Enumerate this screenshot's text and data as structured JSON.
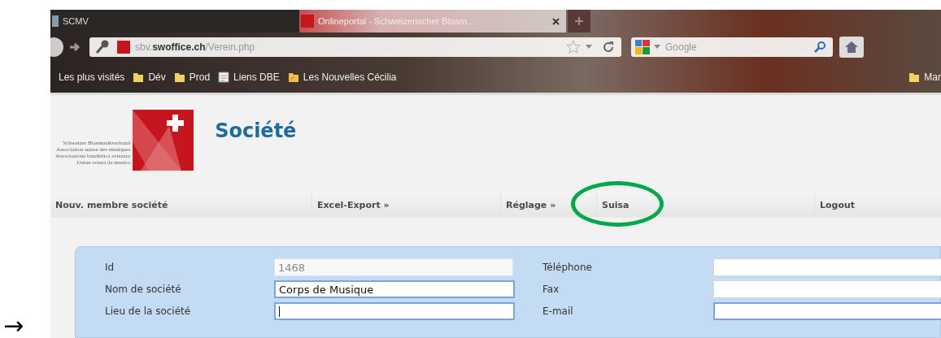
{
  "side_arrow": "→",
  "browser": {
    "tabs": [
      {
        "label": "SCMV",
        "selected": false
      },
      {
        "label": "Onlineportal - Schweizerischer Blasm…",
        "selected": true
      }
    ],
    "address": {
      "prefix": "sbv.",
      "domain": "swoffice.ch",
      "path": "/Verein.php"
    },
    "search": {
      "placeholder": "Google"
    },
    "bookmarks": [
      {
        "label": "Les plus visités",
        "kind": "text"
      },
      {
        "label": "Dév",
        "kind": "folder"
      },
      {
        "label": "Prod",
        "kind": "folder"
      },
      {
        "label": "Liens DBE",
        "kind": "page"
      },
      {
        "label": "Les Nouvelles Cécilia",
        "kind": "feed"
      },
      {
        "label": "Mar",
        "kind": "folder-right"
      }
    ]
  },
  "page": {
    "logo_lines": [
      "Schweizer Blasmusikverband",
      "Association suisse des musiques",
      "Associazione bandistica svizzera",
      "Uniun svizra da musica"
    ],
    "title": "Société",
    "nav": [
      {
        "label": "Nouv. membre société",
        "circled": false
      },
      {
        "label": "Excel-Export »",
        "circled": false
      },
      {
        "label": "Réglage »",
        "circled": false
      },
      {
        "label": "Suisa",
        "circled": true
      },
      {
        "label": "Logout",
        "circled": false
      }
    ],
    "form": {
      "left": [
        {
          "label": "Id",
          "value": "1468",
          "disabled": true,
          "focused": false
        },
        {
          "label": "Nom de société",
          "value": "Corps de Musique",
          "disabled": false,
          "focused": true
        },
        {
          "label": "Lieu de la société",
          "disabled": false,
          "focused": true,
          "caret": true
        }
      ],
      "right": [
        {
          "label": "Téléphone",
          "disabled": false,
          "focused": false
        },
        {
          "label": "Fax",
          "disabled": false,
          "focused": false
        },
        {
          "label": "E-mail",
          "disabled": false,
          "focused": true
        }
      ]
    }
  }
}
